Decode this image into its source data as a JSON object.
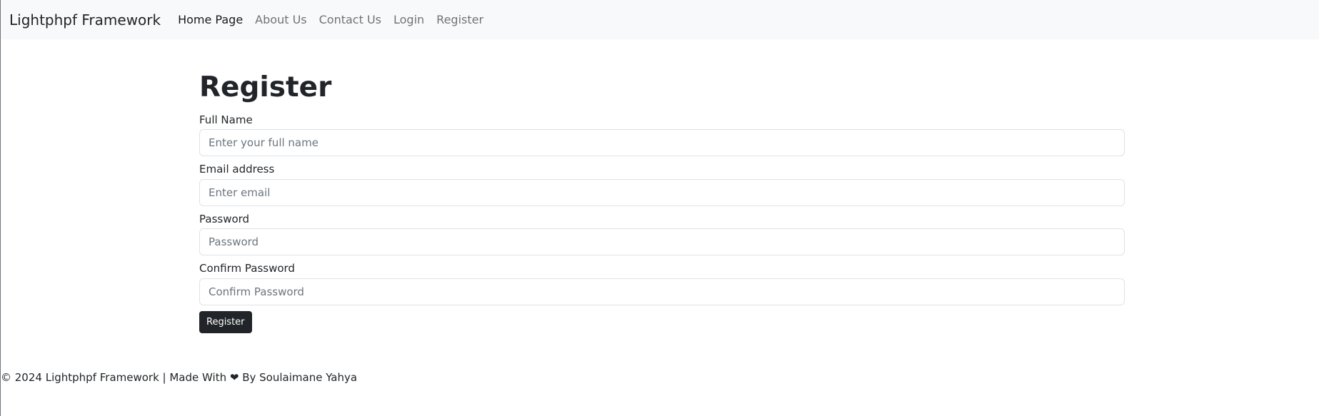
{
  "navbar": {
    "brand": "Lightphpf Framework",
    "links": [
      {
        "label": "Home Page",
        "active": true
      },
      {
        "label": "About Us",
        "active": false
      },
      {
        "label": "Contact Us",
        "active": false
      },
      {
        "label": "Login",
        "active": false
      },
      {
        "label": "Register",
        "active": false
      }
    ]
  },
  "page": {
    "title": "Register"
  },
  "form": {
    "fields": [
      {
        "label": "Full Name",
        "placeholder": "Enter your full name",
        "value": ""
      },
      {
        "label": "Email address",
        "placeholder": "Enter email",
        "value": ""
      },
      {
        "label": "Password",
        "placeholder": "Password",
        "value": ""
      },
      {
        "label": "Confirm Password",
        "placeholder": "Confirm Password",
        "value": ""
      }
    ],
    "submit_label": "Register"
  },
  "footer": {
    "prefix": "© 2024 Lightphpf Framework | Made With",
    "heart_icon": "heart-icon",
    "suffix": "By Soulaimane Yahya"
  },
  "colors": {
    "navbar_bg": "#f8f9fa",
    "button_bg": "#212529",
    "text": "#212529"
  }
}
